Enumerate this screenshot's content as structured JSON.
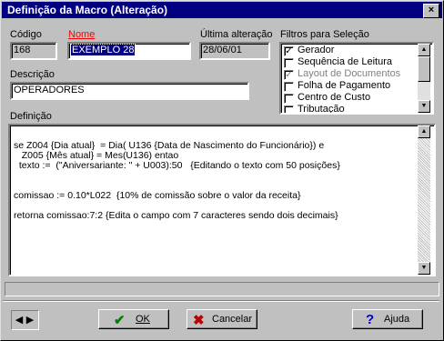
{
  "window": {
    "title": "Definição da Macro (Alteração)",
    "close_glyph": "×"
  },
  "fields": {
    "codigo_label": "Código",
    "codigo_value": "168",
    "nome_label": "Nome",
    "nome_value": "EXEMPLO 28",
    "ultima_label": "Última alteração",
    "ultima_value": "28/06/01",
    "descricao_label": "Descrição",
    "descricao_value": "OPERADORES",
    "definicao_label": "Definição"
  },
  "filters": {
    "label": "Filtros para Seleção",
    "items": [
      {
        "label": "Gerador",
        "checked": true,
        "enabled": true,
        "mark": "✓"
      },
      {
        "label": "Sequência de Leitura",
        "checked": false,
        "enabled": true,
        "mark": ""
      },
      {
        "label": "Layout de Documentos",
        "checked": true,
        "enabled": false,
        "mark": "✓"
      },
      {
        "label": "Folha de Pagamento",
        "checked": false,
        "enabled": true,
        "mark": ""
      },
      {
        "label": "Centro de Custo",
        "checked": false,
        "enabled": true,
        "mark": ""
      },
      {
        "label": "Tributação",
        "checked": false,
        "enabled": true,
        "mark": ""
      }
    ]
  },
  "definition": {
    "lines": [
      "se Z004 {Dia atual}  = Dia( U136 {Data de Nascimento do Funcionário}) e",
      "   Z005 {Mês atual} = Mes(U136) entao",
      "  texto :=  (\"Aniversariante: \" + U003):50   {Editando o texto com 50 posições}",
      "",
      "",
      "comissao := 0.10*L022  {10% de comissão sobre o valor da receita}",
      "",
      "retorna comissao:7:2 {Edita o campo com 7 caracteres sendo dois decimais}"
    ]
  },
  "buttons": {
    "ok": {
      "label": "OK",
      "icon": "check-icon",
      "color": "#008000"
    },
    "cancel": {
      "label": "Cancelar",
      "icon": "x-icon",
      "color": "#c00000"
    },
    "help": {
      "label": "Ajuda",
      "icon": "question-icon",
      "color": "#0000c0"
    }
  },
  "nav": {
    "prev": "◀",
    "next": "▶"
  },
  "colors": {
    "title_bg": "#000080",
    "nome_label": "#ff0000",
    "selection": "#000080"
  }
}
